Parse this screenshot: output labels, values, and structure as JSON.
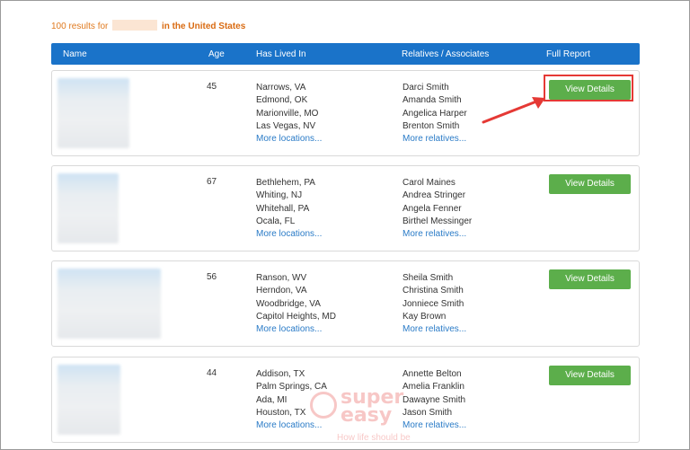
{
  "summary": {
    "count_text": "100 results for",
    "location": "in the United States"
  },
  "header": {
    "name": "Name",
    "age": "Age",
    "lived": "Has Lived In",
    "relatives": "Relatives / Associates",
    "report": "Full Report"
  },
  "results": [
    {
      "age": "45",
      "locations": [
        "Narrows, VA",
        "Edmond, OK",
        "Marionville, MO",
        "Las Vegas, NV"
      ],
      "more_locations": "More locations...",
      "relatives": [
        "Darci Smith",
        "Amanda Smith",
        "Angelica Harper",
        "Brenton Smith"
      ],
      "more_relatives": "More relatives...",
      "button": "View Details"
    },
    {
      "age": "67",
      "locations": [
        "Bethlehem, PA",
        "Whiting, NJ",
        "Whitehall, PA",
        "Ocala, FL"
      ],
      "more_locations": "More locations...",
      "relatives": [
        "Carol Maines",
        "Andrea Stringer",
        "Angela Fenner",
        "Birthel Messinger"
      ],
      "more_relatives": "More relatives...",
      "button": "View Details"
    },
    {
      "age": "56",
      "locations": [
        "Ranson, WV",
        "Herndon, VA",
        "Woodbridge, VA",
        "Capitol Heights, MD"
      ],
      "more_locations": "More locations...",
      "relatives": [
        "Sheila Smith",
        "Christina Smith",
        "Jonniece Smith",
        "Kay Brown"
      ],
      "more_relatives": "More relatives...",
      "button": "View Details"
    },
    {
      "age": "44",
      "locations": [
        "Addison, TX",
        "Palm Springs, CA",
        "Ada, MI",
        "Houston, TX"
      ],
      "more_locations": "More locations...",
      "relatives": [
        "Annette Belton",
        "Amelia Franklin",
        "Dawayne Smith",
        "Jason Smith"
      ],
      "more_relatives": "More relatives...",
      "button": "View Details"
    }
  ],
  "watermark": {
    "line1": "super",
    "line2": "easy",
    "tagline": "How life should be"
  },
  "colors": {
    "header_bg": "#1a73c9",
    "button_bg": "#5cae4b",
    "annotation": "#e53935",
    "summary_text": "#e07a1f",
    "link": "#2a7bc7"
  }
}
